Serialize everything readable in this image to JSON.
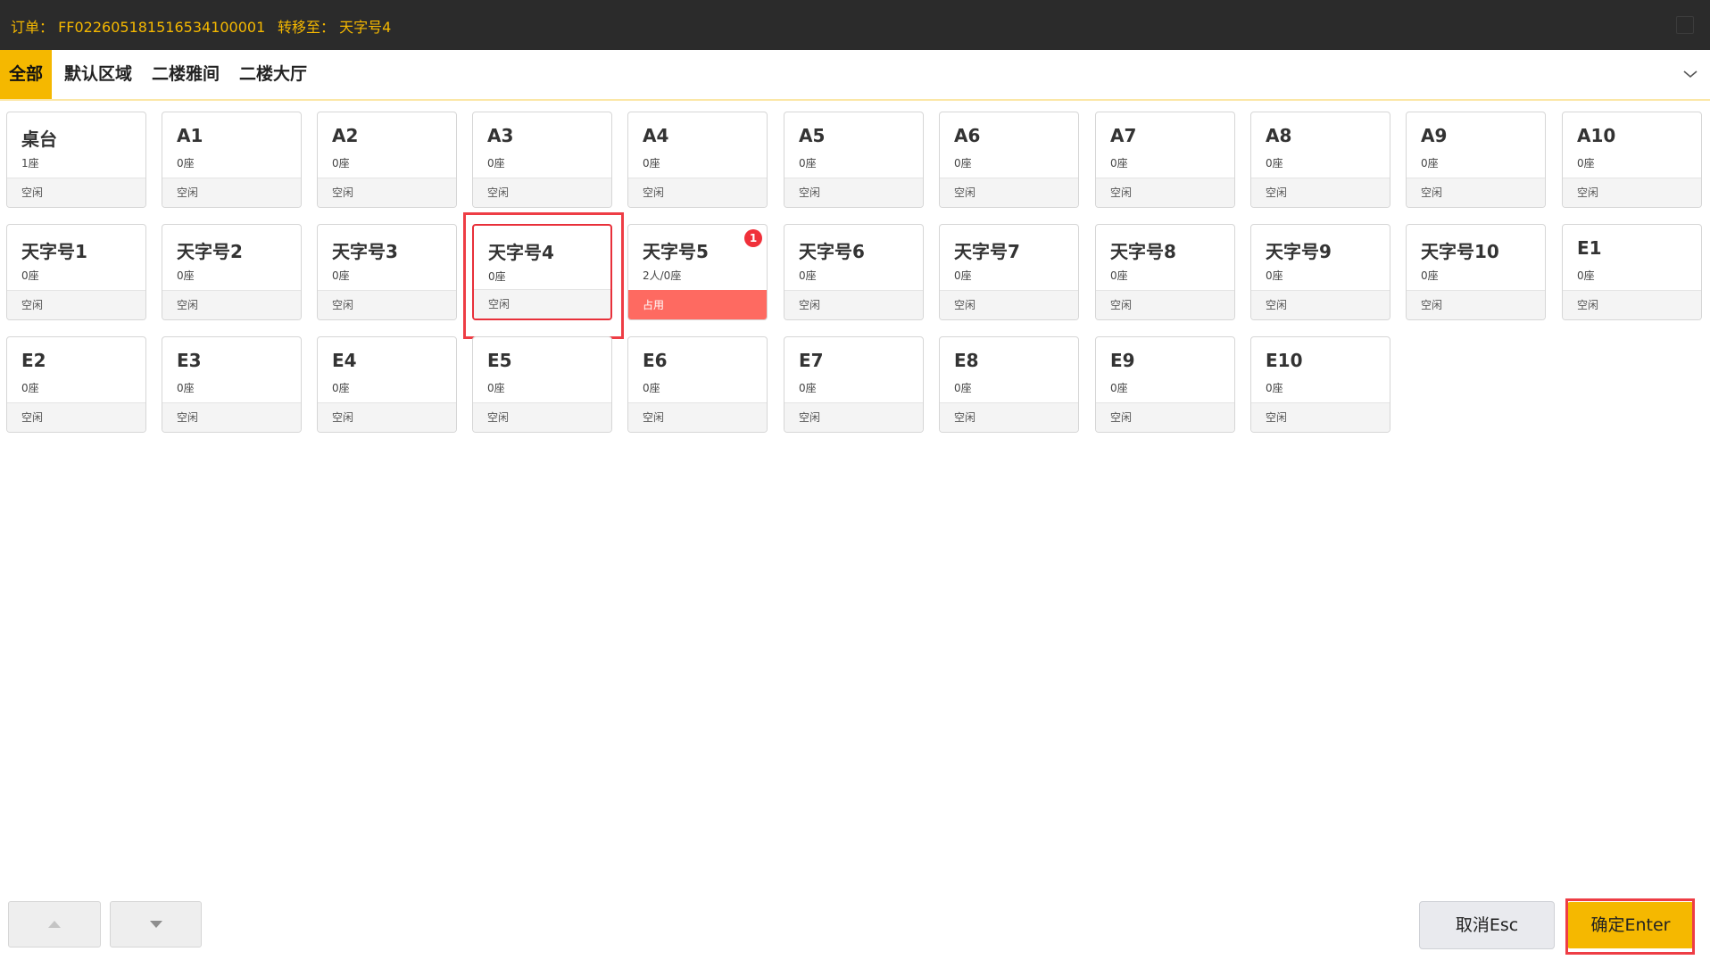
{
  "header": {
    "order_text": "订单：  FF022605181516534100001",
    "transfer_text": "转移至：  天字号4"
  },
  "tabs": [
    {
      "label": "全部",
      "active": true
    },
    {
      "label": "默认区域",
      "active": false
    },
    {
      "label": "二楼雅间",
      "active": false
    },
    {
      "label": "二楼大厅",
      "active": false
    }
  ],
  "tables": [
    {
      "name": "桌台",
      "seats": "1座",
      "status": "空闲"
    },
    {
      "name": "A1",
      "seats": "0座",
      "status": "空闲"
    },
    {
      "name": "A2",
      "seats": "0座",
      "status": "空闲"
    },
    {
      "name": "A3",
      "seats": "0座",
      "status": "空闲"
    },
    {
      "name": "A4",
      "seats": "0座",
      "status": "空闲"
    },
    {
      "name": "A5",
      "seats": "0座",
      "status": "空闲"
    },
    {
      "name": "A6",
      "seats": "0座",
      "status": "空闲"
    },
    {
      "name": "A7",
      "seats": "0座",
      "status": "空闲"
    },
    {
      "name": "A8",
      "seats": "0座",
      "status": "空闲"
    },
    {
      "name": "A9",
      "seats": "0座",
      "status": "空闲"
    },
    {
      "name": "A10",
      "seats": "0座",
      "status": "空闲"
    },
    {
      "name": "天字号1",
      "seats": "0座",
      "status": "空闲"
    },
    {
      "name": "天字号2",
      "seats": "0座",
      "status": "空闲"
    },
    {
      "name": "天字号3",
      "seats": "0座",
      "status": "空闲"
    },
    {
      "name": "天字号4",
      "seats": "0座",
      "status": "空闲",
      "selected": true
    },
    {
      "name": "天字号5",
      "seats": "2人/0座",
      "status": "占用",
      "occupied": true,
      "badge": "1"
    },
    {
      "name": "天字号6",
      "seats": "0座",
      "status": "空闲"
    },
    {
      "name": "天字号7",
      "seats": "0座",
      "status": "空闲"
    },
    {
      "name": "天字号8",
      "seats": "0座",
      "status": "空闲"
    },
    {
      "name": "天字号9",
      "seats": "0座",
      "status": "空闲"
    },
    {
      "name": "天字号10",
      "seats": "0座",
      "status": "空闲"
    },
    {
      "name": "E1",
      "seats": "0座",
      "status": "空闲"
    },
    {
      "name": "E2",
      "seats": "0座",
      "status": "空闲"
    },
    {
      "name": "E3",
      "seats": "0座",
      "status": "空闲"
    },
    {
      "name": "E4",
      "seats": "0座",
      "status": "空闲"
    },
    {
      "name": "E5",
      "seats": "0座",
      "status": "空闲"
    },
    {
      "name": "E6",
      "seats": "0座",
      "status": "空闲"
    },
    {
      "name": "E7",
      "seats": "0座",
      "status": "空闲"
    },
    {
      "name": "E8",
      "seats": "0座",
      "status": "空闲"
    },
    {
      "name": "E9",
      "seats": "0座",
      "status": "空闲"
    },
    {
      "name": "E10",
      "seats": "0座",
      "status": "空闲"
    }
  ],
  "footer": {
    "page_up_icon": "triangle-up-icon",
    "page_down_icon": "triangle-down-icon",
    "cancel_label": "取消Esc",
    "confirm_label": "确定Enter"
  },
  "colors": {
    "accent": "#f5b800",
    "occupied": "#fe6a61",
    "selection": "#ee3d45",
    "topbar": "#2b2b2b"
  }
}
